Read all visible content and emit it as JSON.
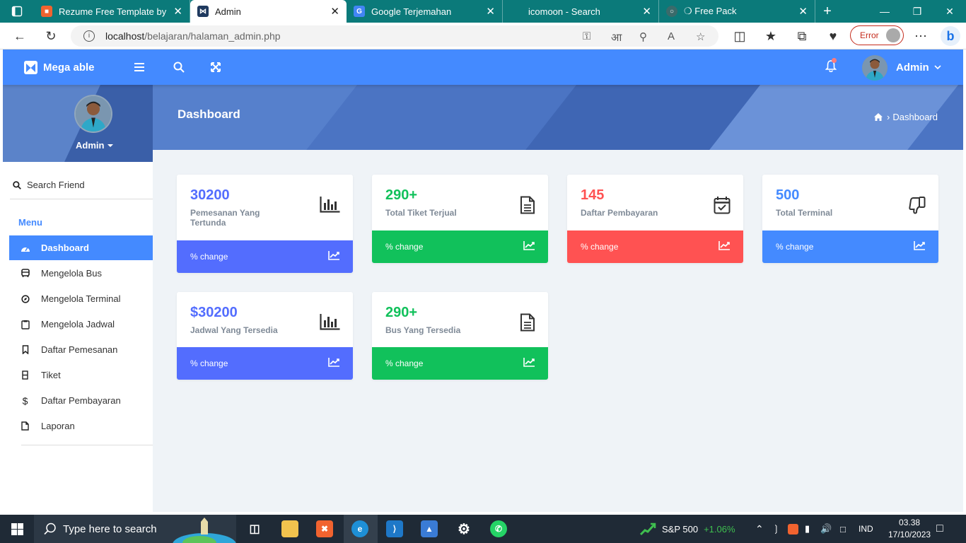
{
  "browser": {
    "tabs": [
      {
        "title": "Rezume Free Template by Col",
        "icon": "xampp-icon",
        "color": "#f1632f",
        "active": false
      },
      {
        "title": "Admin",
        "icon": "megaable-icon",
        "color": "#1f3a5f",
        "active": true
      },
      {
        "title": "Google Terjemahan",
        "icon": "google-translate-icon",
        "color": "#4285f4",
        "active": false
      },
      {
        "title": "icomoon - Search",
        "icon": "none",
        "color": "",
        "active": false
      },
      {
        "title": "❍ Free Pack",
        "icon": "web-icon",
        "color": "#3a6b6b",
        "active": false
      }
    ],
    "url_host": "localhost",
    "url_path": "/belajaran/halaman_admin.php",
    "error_label": "Error"
  },
  "app": {
    "brand": "Mega able",
    "user_name": "Admin",
    "sidebar": {
      "user_name": "Admin",
      "search_label": "Search Friend",
      "menu_heading": "Menu",
      "items": [
        {
          "label": "Dashboard",
          "icon": "dashboard-icon",
          "active": true
        },
        {
          "label": "Mengelola Bus",
          "icon": "bus-icon",
          "active": false
        },
        {
          "label": "Mengelola Terminal",
          "icon": "compass-icon",
          "active": false
        },
        {
          "label": "Mengelola Jadwal",
          "icon": "clipboard-icon",
          "active": false
        },
        {
          "label": "Daftar Pemesanan",
          "icon": "bookmark-icon",
          "active": false
        },
        {
          "label": "Tiket",
          "icon": "ticket-icon",
          "active": false
        },
        {
          "label": "Daftar Pembayaran",
          "icon": "dollar-icon",
          "active": false
        },
        {
          "label": "Laporan",
          "icon": "file-icon",
          "active": false
        }
      ]
    },
    "page": {
      "title": "Dashboard",
      "breadcrumb": "Dashboard"
    },
    "cards": [
      {
        "value": "30200",
        "label": "Pemesanan Yang Tertunda",
        "footer": "% change",
        "color": "#536dfe",
        "icon": "bar-chart-icon"
      },
      {
        "value": "290+",
        "label": "Total Tiket Terjual",
        "footer": "% change",
        "color": "#11c15b",
        "icon": "document-icon"
      },
      {
        "value": "145",
        "label": "Daftar Pembayaran",
        "footer": "% change",
        "color": "#ff5252",
        "icon": "calendar-check-icon"
      },
      {
        "value": "500",
        "label": "Total Terminal",
        "footer": "% change",
        "color": "#448aff",
        "icon": "thumbs-down-icon"
      },
      {
        "value": "$30200",
        "label": "Jadwal Yang Tersedia",
        "footer": "% change",
        "color": "#536dfe",
        "icon": "bar-chart-icon"
      },
      {
        "value": "290+",
        "label": "Bus Yang Tersedia",
        "footer": "% change",
        "color": "#11c15b",
        "icon": "document-icon"
      }
    ]
  },
  "taskbar": {
    "search_placeholder": "Type here to search",
    "stock_name": "S&P 500",
    "stock_change": "+1.06%",
    "language": "IND",
    "time": "03.38",
    "date": "17/10/2023"
  }
}
